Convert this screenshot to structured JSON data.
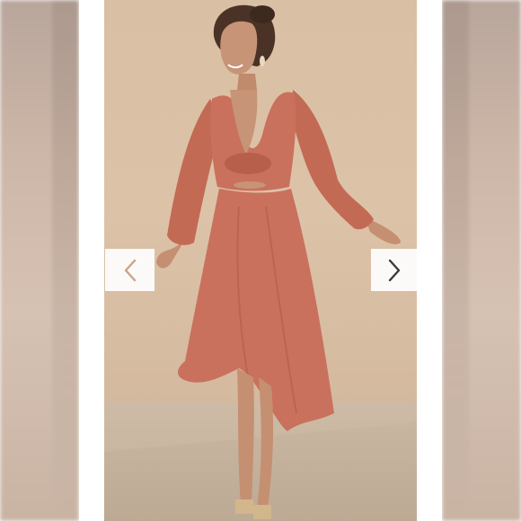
{
  "gallery": {
    "prev_icon": "chevron-left-icon",
    "next_icon": "chevron-right-icon",
    "prev_color": "#c9a48a",
    "next_color": "#3a3a3a"
  },
  "photo": {
    "dress_color": "#c9715d",
    "wall_color": "#dcc3a8"
  }
}
